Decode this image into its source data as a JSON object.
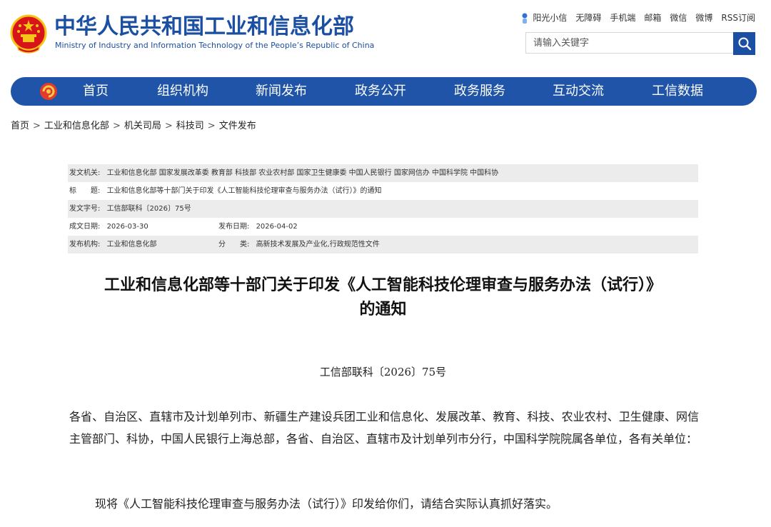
{
  "header": {
    "site_name_cn": "中华人民共和国工业和信息化部",
    "site_name_en": "Ministry of Industry and Information Technology of the People’s Republic of China",
    "top_links": [
      "阳光小信",
      "无障碍",
      "手机端",
      "邮箱",
      "微信",
      "微博",
      "RSS订阅"
    ],
    "search_placeholder": "请输入关键字"
  },
  "nav": {
    "items": [
      "首页",
      "组织机构",
      "新闻发布",
      "政务公开",
      "政务服务",
      "互动交流",
      "工信数据"
    ]
  },
  "breadcrumb": [
    "首页",
    "工业和信息化部",
    "机关司局",
    "科技司",
    "文件发布"
  ],
  "breadcrumb_separator": ">",
  "meta": {
    "issuer_key": "发文机关:",
    "issuer_value": "工业和信息化部 国家发展改革委 教育部 科技部 农业农村部 国家卫生健康委 中国人民银行 国家网信办 中国科学院 中国科协",
    "title_key": "标　　题:",
    "title_value": "工业和信息化部等十部门关于印发《人工智能科技伦理审查与服务办法（试行）》的通知",
    "docno_key": "发文字号:",
    "docno_value": "工信部联科〔2026〕75号",
    "written_key": "成文日期:",
    "written_value": "2026-03-30",
    "published_key": "发布日期:",
    "published_value": "2026-04-02",
    "org_key": "发布机构:",
    "org_value": "工业和信息化部",
    "category_key": "分　　类:",
    "category_value": "高新技术发展及产业化,行政规范性文件"
  },
  "article": {
    "title_line1": "工业和信息化部等十部门关于印发《人工智能科技伦理审查与服务办法（试行）》",
    "title_line2": "的通知",
    "doc_number": "工信部联科〔2026〕75号",
    "paragraph1": "各省、自治区、直辖市及计划单列市、新疆生产建设兵团工业和信息化、发展改革、教育、科技、农业农村、卫生健康、网信主管部门、科协，中国人民银行上海总部，各省、自治区、直辖市及计划单列市分行，中国科学院院属各单位，各有关单位：",
    "paragraph2": "现将《人工智能科技伦理审查与服务办法（试行）》印发给你们，请结合实际认真抓好落实。"
  },
  "colors": {
    "brand_blue": "#1f54a8",
    "emblem_red": "#d7141a",
    "emblem_gold": "#f5c518"
  }
}
